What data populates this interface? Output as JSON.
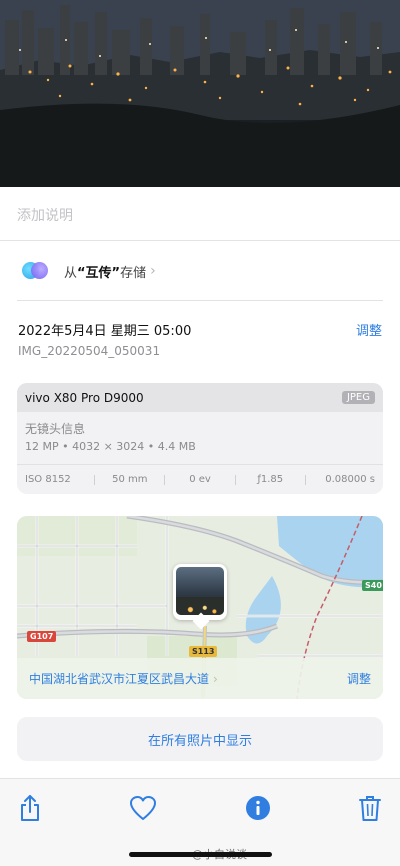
{
  "caption": {
    "placeholder": "添加说明"
  },
  "share": {
    "prefix": "从",
    "app": "“互传”",
    "suffix": "存储",
    "chevron": "›",
    "icon": "shared-circles-icon"
  },
  "photo_info": {
    "datetime": "2022年5月4日 星期三 05:00",
    "adjust_label": "调整",
    "filename": "IMG_20220504_050031"
  },
  "camera": {
    "model": "vivo X80 Pro D9000",
    "format": "JPEG",
    "lens": "无镜头信息",
    "specs": "12 MP  •  4032 × 3024  •  4.4 MB",
    "exif": {
      "iso": "ISO 8152",
      "focal": "50 mm",
      "ev": "0 ev",
      "aperture": "ƒ1.85",
      "shutter": "0.08000 s"
    }
  },
  "map": {
    "location": "中国湖北省武汉市江夏区武昌大道",
    "chevron": "›",
    "adjust_label": "调整",
    "roads": {
      "g107": "G107",
      "s113": "S113",
      "s40": "S40"
    }
  },
  "show_all_label": "在所有照片中显示",
  "toolbar": {
    "share_icon": "share-icon",
    "favorite_icon": "heart-icon",
    "info_icon": "info-icon",
    "delete_icon": "trash-icon"
  },
  "watermark": "@小白说谈",
  "colors": {
    "accent": "#2f7ee0",
    "card_bg": "#f2f2f4",
    "badge_red": "#d9463b",
    "badge_yellow": "#e8b93a",
    "badge_green": "#3b9a5a"
  }
}
